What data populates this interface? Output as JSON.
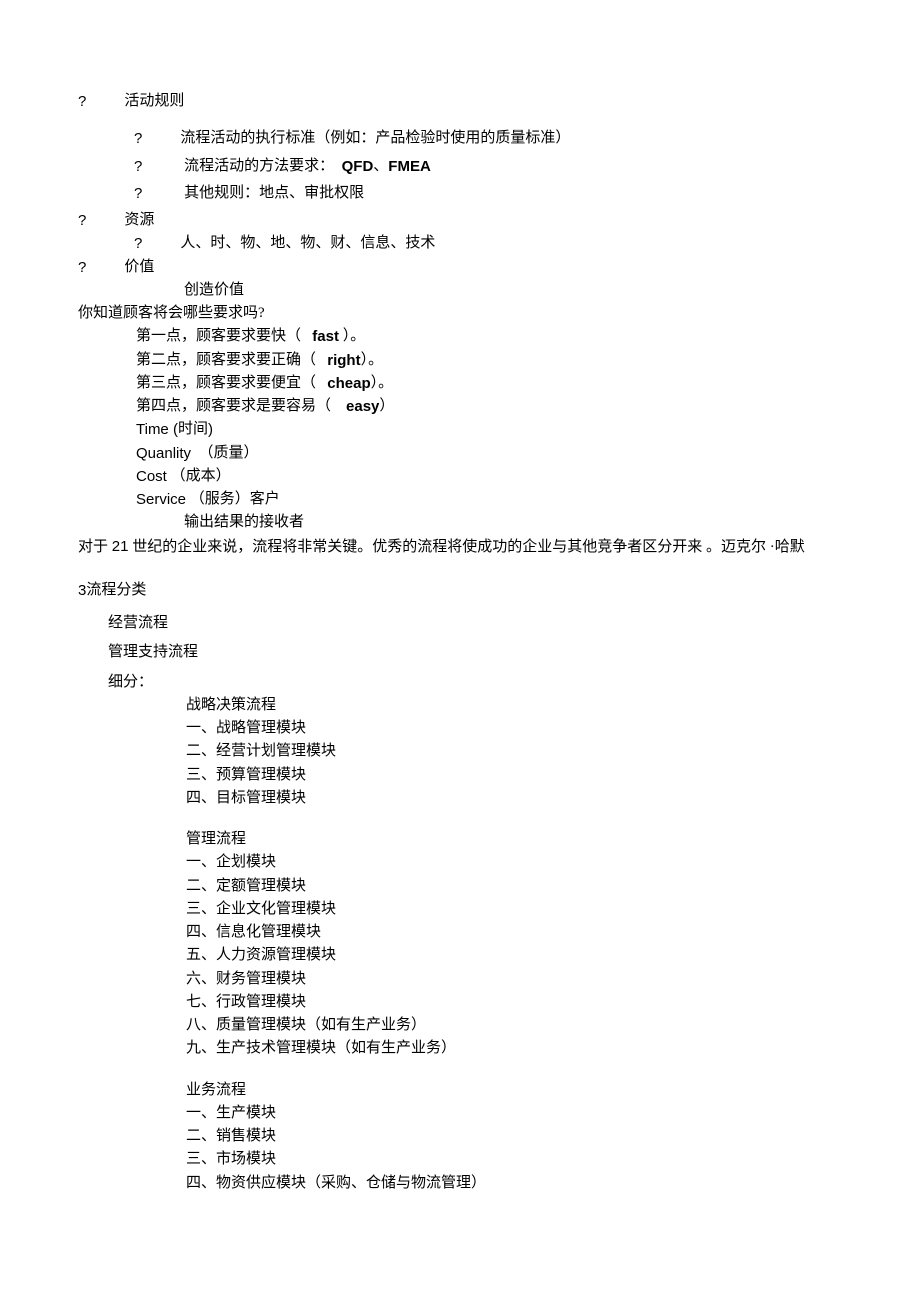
{
  "l1": {
    "q": "?",
    "t": "活动规则"
  },
  "l2": {
    "q": "?",
    "t": "流程活动的执行标准（例如：产品检验时使用的质量标准）"
  },
  "l3": {
    "q": "?",
    "pre": "流程活动的方法要求：",
    "b1": "QFD",
    "mid": " 、",
    "b2": "FMEA"
  },
  "l4": {
    "q": "?",
    "t": "其他规则：地点、审批权限"
  },
  "l5": {
    "q": "?",
    "t": "资源"
  },
  "l6": {
    "q": "?",
    "t": "人、时、物、地、物、财、信息、技术"
  },
  "l7": {
    "q": "?",
    "t": "价值"
  },
  "l8": "创造价值",
  "l9": "你知道顾客将会哪些要求吗?",
  "l10": {
    "pre": "第一点，顾客要求要快（",
    "b": "fast",
    "post": "）。"
  },
  "l11": {
    "pre": "第二点，顾客要求要正确（",
    "b": "right",
    "post": "）。"
  },
  "l12": {
    "pre": "第三点，顾客要求要便宜（",
    "b": "cheap",
    "post": "）。"
  },
  "l13": {
    "pre": "第四点，顾客要求是要容易（",
    "b": "easy",
    "post": "）"
  },
  "l14": {
    "a": "Time (",
    "b": " 时间 ",
    "c": ")"
  },
  "l15": {
    "a": "Quanlity",
    "b": "（质量）"
  },
  "l16": {
    "a": "Cost",
    "b": "（成本）"
  },
  "l17": {
    "a": "Service",
    "b": "（服务）客户"
  },
  "l18": "输出结果的接收者",
  "l19a": "对于 ",
  "l19b": "21",
  "l19c": " 世纪的企业来说，流程将非常关键。优秀的流程将使成功的企业与其他竞争者区分开来 。迈克尔  ·哈默",
  "s3": {
    "num": "3",
    "title": " 流程分类"
  },
  "cat1": "经营流程",
  "cat2": "管理支持流程",
  "cat3": "细分：",
  "g1_t": "战略决策流程",
  "g1_1": "一、战略管理模块",
  "g1_2": "二、经营计划管理模块",
  "g1_3": "三、预算管理模块",
  "g1_4": "四、目标管理模块",
  "g2_t": "管理流程",
  "g2_1": "一、企划模块",
  "g2_2": "二、定额管理模块",
  "g2_3": "三、企业文化管理模块",
  "g2_4": "四、信息化管理模块",
  "g2_5": "五、人力资源管理模块",
  "g2_6": "六、财务管理模块",
  "g2_7": "七、行政管理模块",
  "g2_8": "八、质量管理模块（如有生产业务）",
  "g2_9": "九、生产技术管理模块（如有生产业务）",
  "g3_t": "业务流程",
  "g3_1": "一、生产模块",
  "g3_2": "二、销售模块",
  "g3_3": "三、市场模块",
  "g3_4": "四、物资供应模块（采购、仓储与物流管理）"
}
